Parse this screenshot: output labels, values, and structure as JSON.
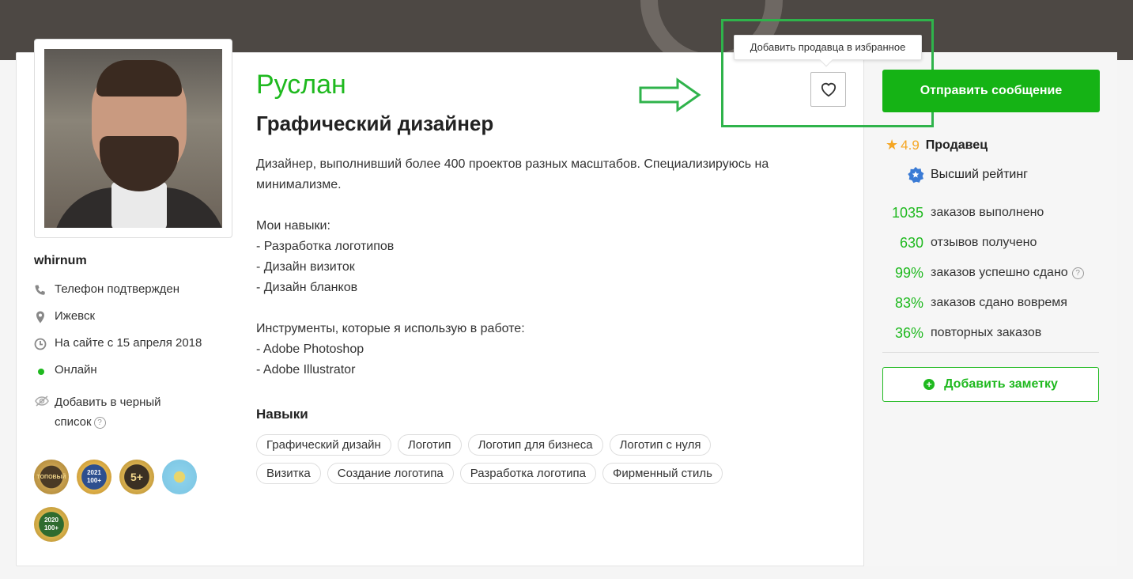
{
  "profile": {
    "name": "Руслан",
    "role": "Графический дизайнер",
    "username": "whirnum",
    "description": [
      "Дизайнер, выполнивший более 400 проектов разных масштабов. Специализируюсь на минимализме.",
      "",
      "Мои навыки:",
      "- Разработка логотипов",
      "- Дизайн визиток",
      "- Дизайн бланков",
      "",
      "Инструменты, которые я использую в работе:",
      "- Adobe Photoshop",
      "- Adobe Illustrator"
    ]
  },
  "info": {
    "phone": "Телефон подтвержден",
    "city": "Ижевск",
    "since": "На сайте с 15 апреля 2018",
    "status": "Онлайн",
    "blacklist": "Добавить в черный список",
    "help": "?"
  },
  "badges": [
    {
      "label": "ТОПОВЫЙ",
      "icon": "top-seller-badge"
    },
    {
      "label": "2021 100+",
      "icon": "year-2021-badge"
    },
    {
      "label": "5+",
      "icon": "five-plus-badge"
    },
    {
      "label": "",
      "icon": "laurel-badge"
    },
    {
      "label": "2020 100+",
      "icon": "year-2020-badge"
    }
  ],
  "skills": {
    "title": "Навыки",
    "tags": [
      "Графический дизайн",
      "Логотип",
      "Логотип для бизнеса",
      "Логотип с нуля",
      "Визитка",
      "Создание логотипа",
      "Разработка логотипа",
      "Фирменный стиль"
    ]
  },
  "favorite": {
    "tooltip": "Добавить продавца в избранное"
  },
  "sidebar": {
    "send_label": "Отправить сообщение",
    "rating": "4.9",
    "rating_label": "Продавец",
    "top_rating": "Высший рейтинг",
    "stats": [
      {
        "num": "1035",
        "text": "заказов выполнено"
      },
      {
        "num": "630",
        "text": "отзывов получено"
      },
      {
        "num": "99%",
        "text": "заказов успешно сдано"
      },
      {
        "num": "83%",
        "text": "заказов сдано вовремя"
      },
      {
        "num": "36%",
        "text": "повторных заказов"
      }
    ],
    "note_label": "Добавить заметку"
  },
  "colors": {
    "accent": "#1fb91f",
    "star": "#f5a623",
    "highlight": "#2fb34b"
  }
}
